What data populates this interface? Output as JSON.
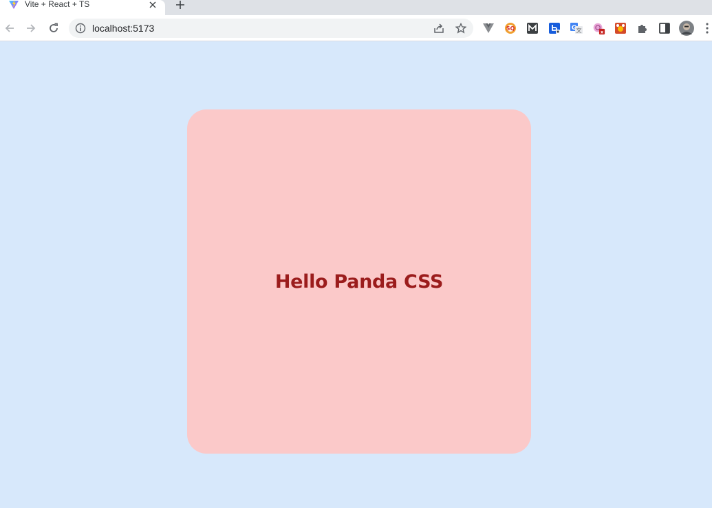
{
  "browser": {
    "tab": {
      "title": "Vite + React + TS",
      "favicon": "vite-logo-icon"
    },
    "toolbar": {
      "back_icon": "arrow-left-icon",
      "forward_icon": "arrow-right-icon",
      "reload_icon": "reload-icon",
      "url": "localhost:5173",
      "site_info_icon": "info-icon",
      "share_icon": "share-icon",
      "bookmark_icon": "star-icon",
      "extensions": [
        "vue-devtools-icon",
        "so-extension-icon",
        "m-extension-icon",
        "bitwarden-icon",
        "google-translate-icon",
        "pocket-icon",
        "devtools-extension-icon",
        "puzzle-icon",
        "side-panel-icon"
      ],
      "profile_icon": "avatar",
      "menu_icon": "kebab-menu-icon"
    }
  },
  "page": {
    "background": "#d7e8fb",
    "card": {
      "heading": "Hello Panda CSS",
      "background": "#fbc9c9",
      "text_color": "#9b1c1c"
    }
  }
}
